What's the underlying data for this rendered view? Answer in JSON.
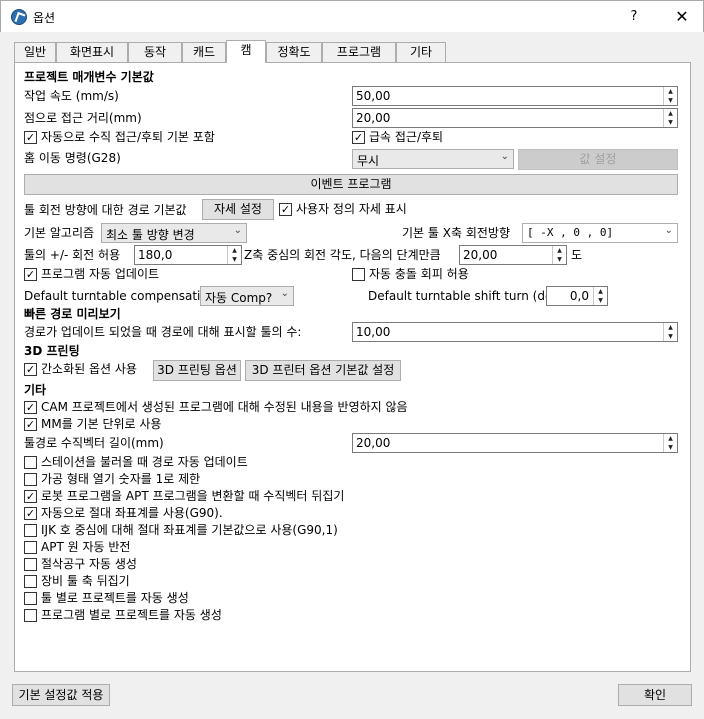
{
  "window": {
    "title": "옵션",
    "help_glyph": "?",
    "close_glyph": "✕"
  },
  "tabs": [
    "일반",
    "화면표시",
    "동작",
    "캐드",
    "캠",
    "정확도",
    "프로그램",
    "기타"
  ],
  "active_tab": "캠",
  "project": {
    "heading": "프로젝트 매개변수 기본값",
    "work_speed_label": "작업 속도 (mm/s)",
    "work_speed_value": "50,00",
    "approach_label": "점으로 접근 거리(mm)",
    "approach_value": "20,00",
    "auto_vertical_label": "자동으로 수직 접근/후퇴 기본 포함",
    "rapid_label": "급속 접근/후퇴",
    "home_label": "홈 이동 명령(G28)",
    "home_value": "무시",
    "value_set_btn": "값 설정",
    "event_program_btn": "이벤트 프로그램"
  },
  "tool": {
    "rotation_path_label": "툴 회전 방향에 대한 경로 기본값",
    "detail_btn": "자세 설정",
    "custom_pose_label": "사용자 정의 자세 표시",
    "algorithm_label": "기본 알고리즘",
    "algorithm_value": "최소 툴 방향 변경",
    "x_rotation_label": "기본 툴 X축 회전방향",
    "x_rotation_value": "[ -X ,    0 ,    0]",
    "tol_label": "툴의 +/- 회전 허용",
    "tol_value": "180,0",
    "z_angle_label": "Z축 중심의 회전 각도, 다음의 단계만큼",
    "z_angle_value": "20,00",
    "deg_label": "도",
    "auto_update_label": "프로그램 자동 업데이트",
    "collision_label": "자동 충돌 회피 허용",
    "turntable_comp_label": "Default turntable compensation",
    "turntable_comp_value": "자동 Comp?",
    "turntable_shift_label": "Default turntable shift turn (deg)",
    "turntable_shift_value": "0,0"
  },
  "preview": {
    "heading": "빠른 경로 미리보기",
    "tools_label": "경로가 업데이트 되었을 때 경로에 대해 표시할 툴의 수:",
    "tools_value": "10,00"
  },
  "printing": {
    "heading": "3D 프린팅",
    "simple_label": "간소화된 옵션 사용",
    "options_btn": "3D 프린팅 옵션",
    "defaults_btn": "3D 프린터 옵션 기본값 설정"
  },
  "etc": {
    "heading": "기타",
    "vector_length_label": "툴경로 수직벡터 길이(mm)",
    "vector_length_value": "20,00",
    "checks": [
      {
        "label": "CAM 프로젝트에서 생성된 프로그램에 대해 수정된 내용을 반영하지 않음",
        "checked": true
      },
      {
        "label": "MM를 기본 단위로 사용",
        "checked": true
      },
      {
        "label": "스테이션을 불러올 때 경로 자동 업데이트",
        "checked": false
      },
      {
        "label": "가공 형태 열기 숫자를 1로 제한",
        "checked": false
      },
      {
        "label": "로봇 프로그램을 APT 프로그램을 변환할 때 수직벡터 뒤집기",
        "checked": true
      },
      {
        "label": "자동으로 절대 좌표계를 사용(G90).",
        "checked": true
      },
      {
        "label": "IJK 호 중심에 대해 절대 좌표계를 기본값으로 사용(G90,1)",
        "checked": false
      },
      {
        "label": "APT 원 자동 반전",
        "checked": false
      },
      {
        "label": "절삭공구 자동 생성",
        "checked": false
      },
      {
        "label": "장비 툴 축 뒤집기",
        "checked": false
      },
      {
        "label": "툴 별로 프로젝트를 자동 생성",
        "checked": false
      },
      {
        "label": "프로그램 별로 프로젝트를 자동 생성",
        "checked": false
      }
    ]
  },
  "footer": {
    "defaults_btn": "기본 설정값 적용",
    "ok_btn": "확인"
  },
  "glyphs": {
    "check": "✓",
    "up": "▲",
    "down": "▼",
    "chevron": "⌄"
  }
}
